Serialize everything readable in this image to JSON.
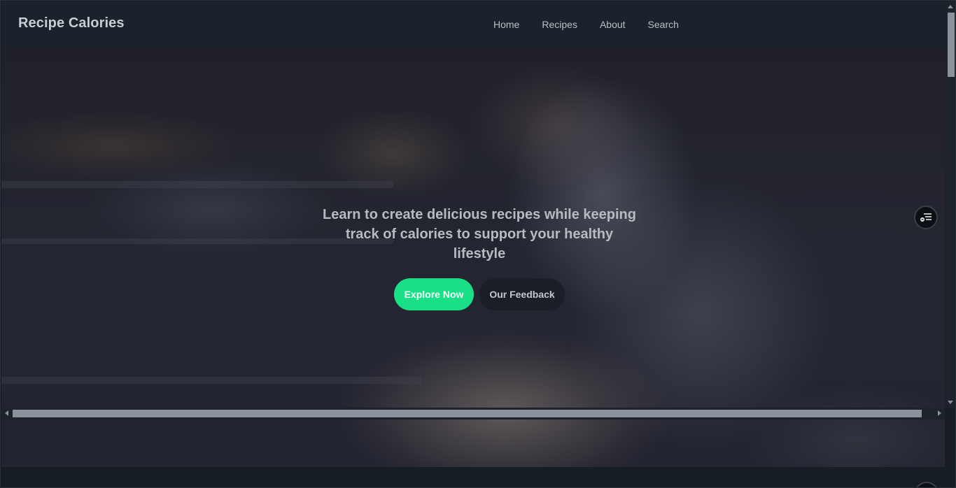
{
  "navbar": {
    "brand": "Recipe Calories",
    "links": [
      "Home",
      "Recipes",
      "About",
      "Search"
    ]
  },
  "hero": {
    "title": "Learn to create delicious recipes while keeping track of calories to support your healthy lifestyle",
    "primary_button": "Explore Now",
    "secondary_button": "Our Feedback",
    "background_image": "chef-cooking-kitchen-photo"
  },
  "widget": {
    "icon": "filter-list-icon"
  },
  "colors": {
    "accent": "#19e087",
    "navbar_bg": "#1b222b",
    "page_bg": "#161d24"
  }
}
